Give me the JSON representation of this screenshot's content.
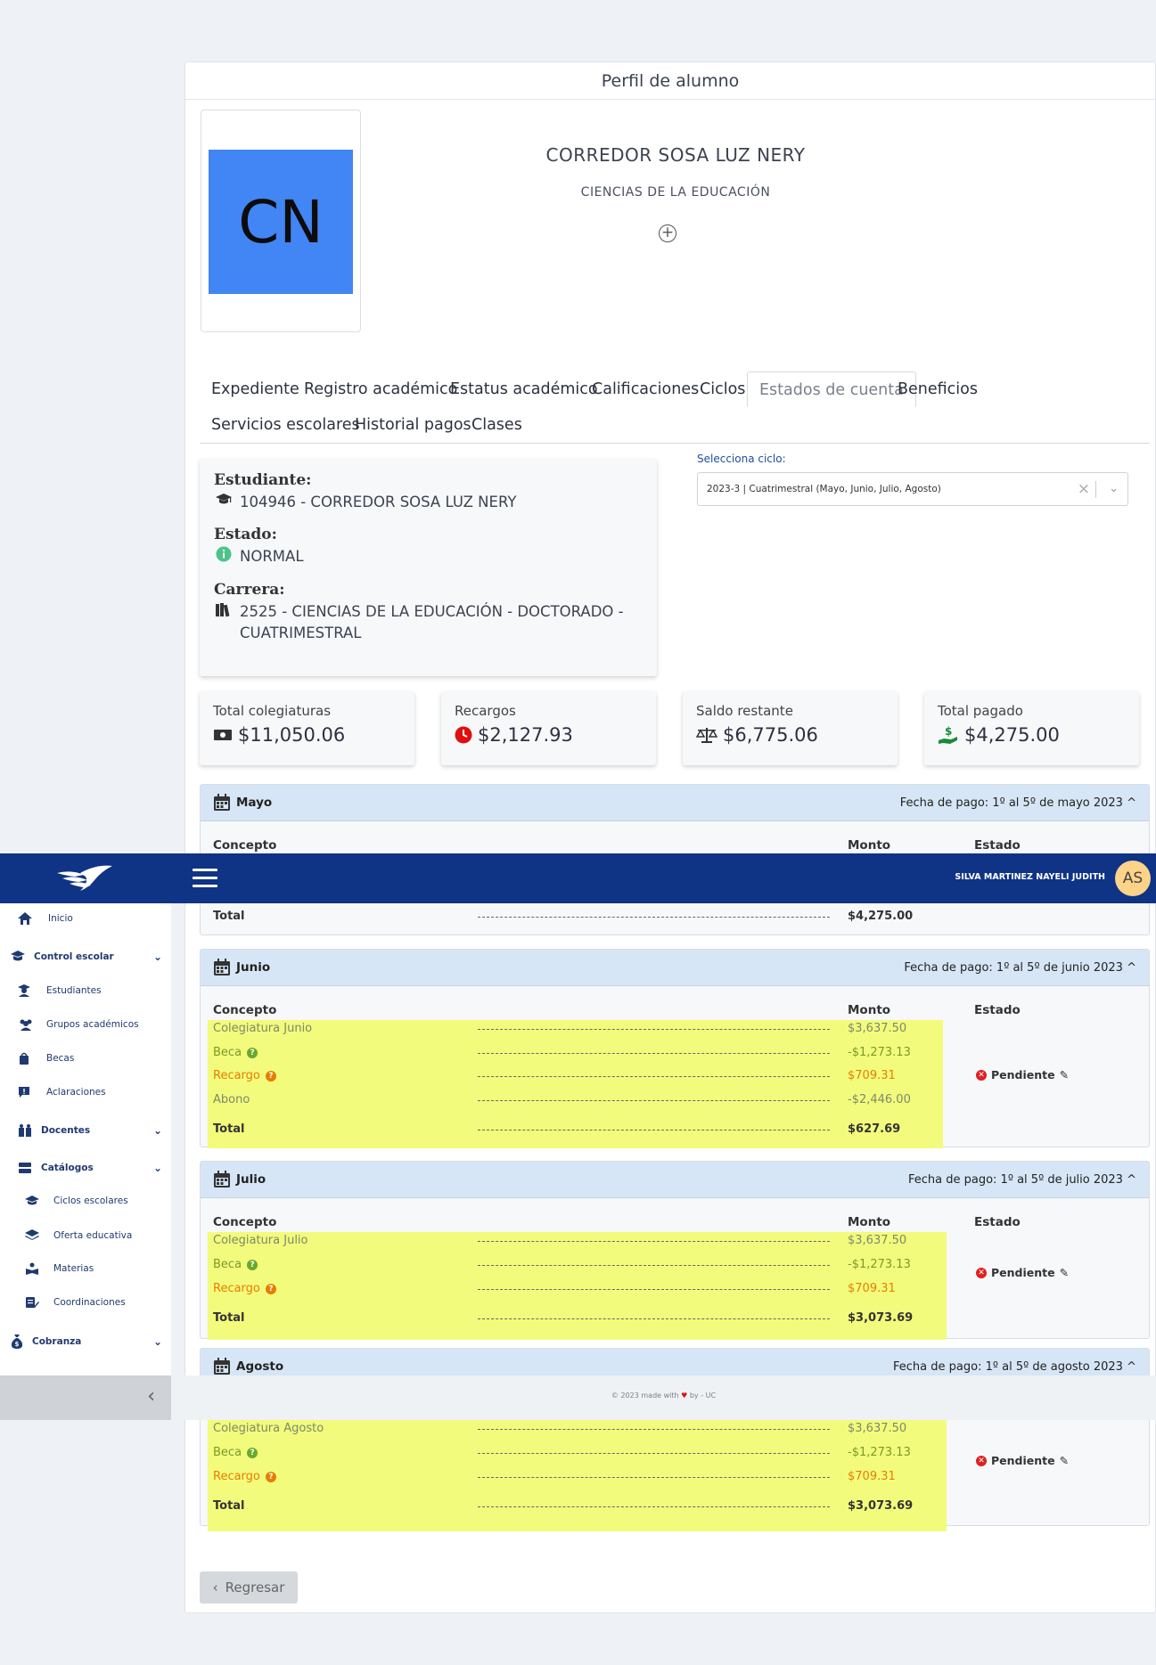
{
  "card": {
    "title": "Perfil de alumno"
  },
  "profile": {
    "initials": "CN",
    "name": "CORREDOR SOSA LUZ NERY",
    "career": "CIENCIAS DE LA EDUCACIÓN"
  },
  "tabs": [
    {
      "label": "Expediente"
    },
    {
      "label": "Registro académico"
    },
    {
      "label": "Estatus académico"
    },
    {
      "label": "Calificaciones"
    },
    {
      "label": "Ciclos"
    },
    {
      "label": "Estados de cuenta",
      "active": true
    },
    {
      "label": "Beneficios"
    },
    {
      "label": "Servicios escolares"
    },
    {
      "label": "Historial pagos"
    },
    {
      "label": "Clases"
    }
  ],
  "info": {
    "student_label": "Estudiante:",
    "student_value": "104946 - CORREDOR SOSA LUZ NERY",
    "status_label": "Estado:",
    "status_value": "NORMAL",
    "career_label": "Carrera:",
    "career_value": "2525 - CIENCIAS DE LA EDUCACIÓN - DOCTORADO - CUATRIMESTRAL"
  },
  "cycle": {
    "label": "Selecciona ciclo:",
    "value": "2023-3 | Cuatrimestral (Mayo, Junio, Julio, Agosto)"
  },
  "stats": [
    {
      "label": "Total colegiaturas",
      "value": "$11,050.06",
      "icon": "money-icon"
    },
    {
      "label": "Recargos",
      "value": "$2,127.93",
      "icon": "clock-icon"
    },
    {
      "label": "Saldo restante",
      "value": "$6,775.06",
      "icon": "scale-icon"
    },
    {
      "label": "Total pagado",
      "value": "$4,275.00",
      "icon": "hand-money-icon"
    }
  ],
  "columns": {
    "concept": "Concepto",
    "amount": "Monto",
    "status": "Estado"
  },
  "months": {
    "mayo": {
      "name": "Mayo",
      "date": "Fecha de pago: 1º al 5º de mayo 2023",
      "total_label": "Total",
      "total": "$4,275.00"
    },
    "junio": {
      "name": "Junio",
      "date": "Fecha de pago: 1º al 5º de junio 2023",
      "rows": [
        {
          "concept": "Colegiatura Junio",
          "amount": "$3,637.50"
        },
        {
          "concept": "Beca",
          "amount": "-$1,273.13"
        },
        {
          "concept": "Recargo",
          "amount": "$709.31"
        },
        {
          "concept": "Abono",
          "amount": "-$2,446.00"
        }
      ],
      "total_label": "Total",
      "total": "$627.69",
      "status": "Pendiente"
    },
    "julio": {
      "name": "Julio",
      "date": "Fecha de pago: 1º al 5º de julio 2023",
      "rows": [
        {
          "concept": "Colegiatura Julio",
          "amount": "$3,637.50"
        },
        {
          "concept": "Beca",
          "amount": "-$1,273.13"
        },
        {
          "concept": "Recargo",
          "amount": "$709.31"
        }
      ],
      "total_label": "Total",
      "total": "$3,073.69",
      "status": "Pendiente"
    },
    "agosto": {
      "name": "Agosto",
      "date": "Fecha de pago: 1º al 5º de agosto 2023",
      "rows": [
        {
          "concept": "Colegiatura Agosto",
          "amount": "$3,637.50"
        },
        {
          "concept": "Beca",
          "amount": "-$1,273.13"
        },
        {
          "concept": "Recargo",
          "amount": "$709.31"
        }
      ],
      "total_label": "Total",
      "total": "$3,073.69",
      "status": "Pendiente"
    }
  },
  "back_label": "Regresar",
  "topbar": {
    "user_name": "SILVA MARTINEZ NAYELI JUDITH",
    "user_initials": "AS"
  },
  "sidebar": {
    "inicio": "Inicio",
    "control_escolar": "Control escolar",
    "estudiantes": "Estudiantes",
    "grupos": "Grupos académicos",
    "becas": "Becas",
    "aclaraciones": "Aclaraciones",
    "docentes": "Docentes",
    "catalogos": "Catálogos",
    "ciclos": "Ciclos escolares",
    "oferta": "Oferta educativa",
    "materias": "Materias",
    "coordinaciones": "Coordinaciones",
    "cobranza": "Cobranza"
  },
  "footer": {
    "before": "© 2023 made with",
    "after": "by - UC"
  }
}
